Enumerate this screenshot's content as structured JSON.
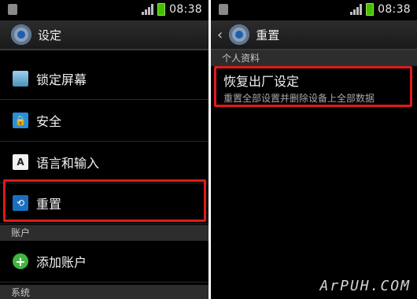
{
  "left_screen": {
    "status_bar": {
      "time": "08:38"
    },
    "action_bar": {
      "title": "设定",
      "icon": "settings-gear-icon"
    },
    "items": [
      {
        "label": "锁定屏幕",
        "icon": "lock-screen-icon"
      },
      {
        "label": "安全",
        "icon": "security-lock-icon"
      },
      {
        "label": "语言和输入",
        "icon": "language-icon",
        "icon_text": "A"
      },
      {
        "label": "重置",
        "icon": "reset-icon"
      }
    ],
    "section_accounts": {
      "header": "账户",
      "add_account_label": "添加账户",
      "icon": "add-icon"
    },
    "section_system": {
      "header": "系统"
    }
  },
  "right_screen": {
    "status_bar": {
      "time": "08:38"
    },
    "action_bar": {
      "title": "重置",
      "icon": "settings-gear-icon",
      "back_icon": "back-arrow-icon"
    },
    "section_header": "个人资料",
    "factory_reset": {
      "title": "恢复出厂设定",
      "subtitle": "重置全部设置并删除设备上全部数据"
    }
  },
  "highlight_color": "#e01a1a",
  "watermark": "ArPUH.COM"
}
